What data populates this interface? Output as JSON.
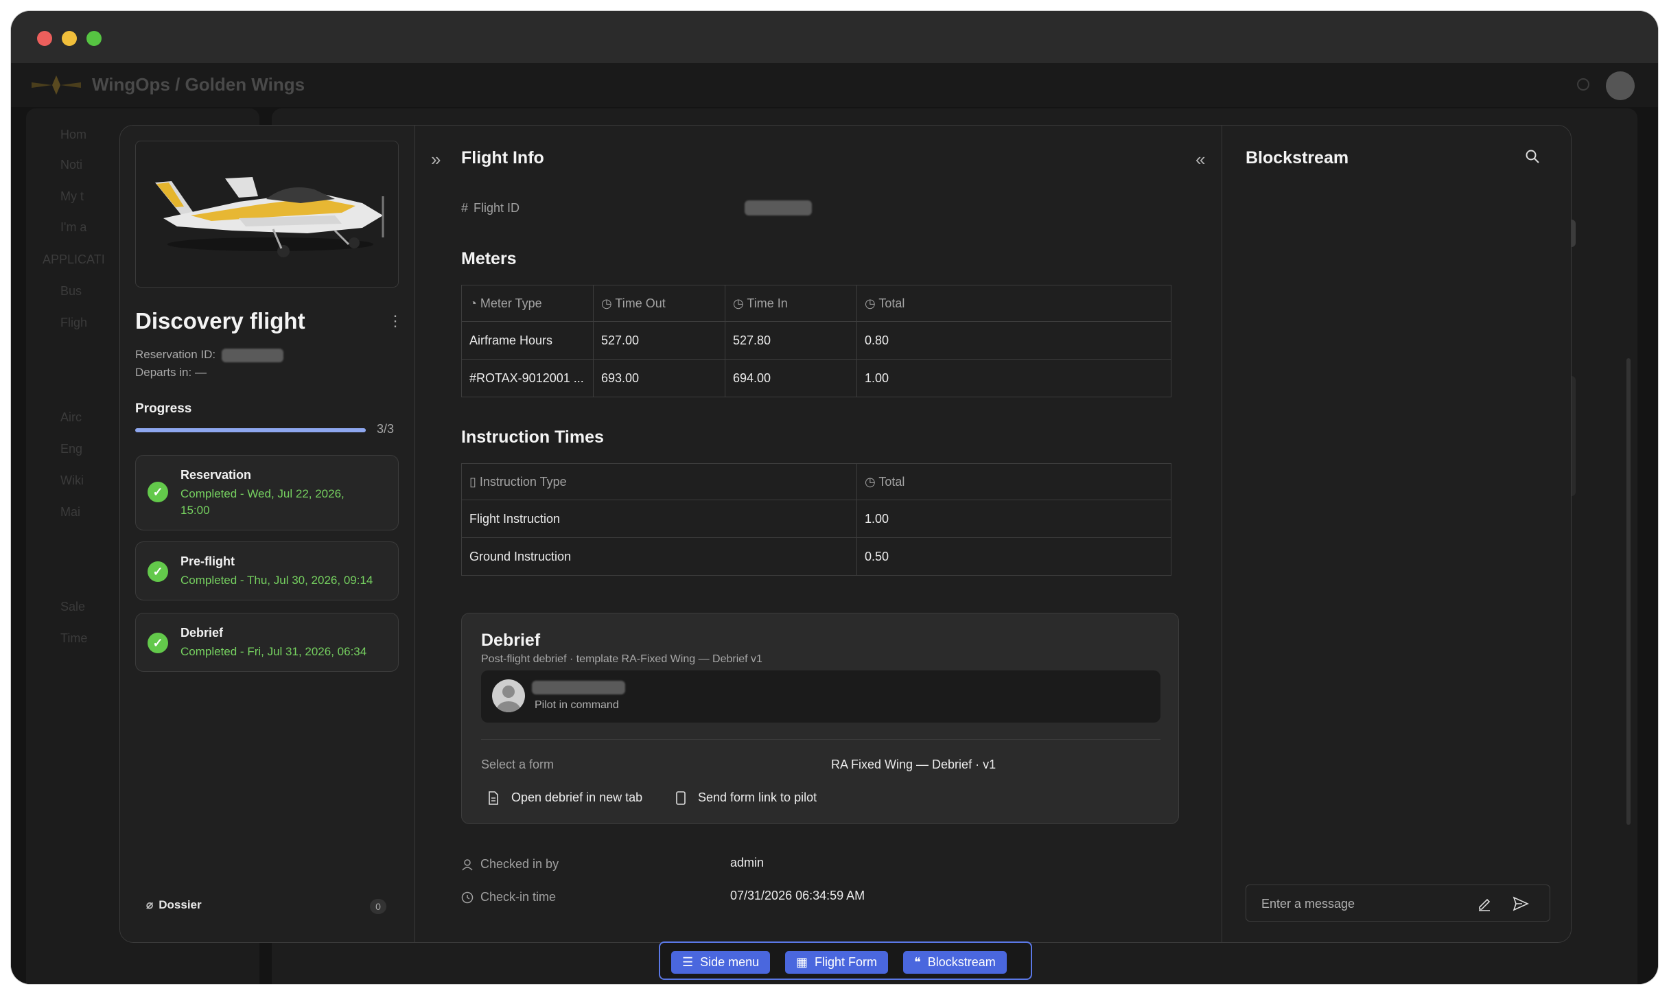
{
  "background_app": {
    "name": "WingOps / Golden Wings",
    "nav_items": [
      "Hom",
      "Noti",
      "My t",
      "I'm a",
      "APPLICATI",
      "Bus",
      "Fligh",
      "Airc",
      "Eng",
      "Wiki",
      "Mai",
      "Sale",
      "Time"
    ]
  },
  "left": {
    "title": "Discovery flight",
    "reservation_label": "Reservation ID:",
    "departs_label": "Departs in:",
    "departs_value": "—",
    "progress_label": "Progress",
    "progress_count": "3/3",
    "progress_fraction": 1.0,
    "steps": [
      {
        "title": "Reservation",
        "status": "Completed - Wed, Jul 22, 2026, 15:00"
      },
      {
        "title": "Pre-flight",
        "status": "Completed - Thu, Jul 30, 2026, 09:14"
      },
      {
        "title": "Debrief",
        "status": "Completed - Fri, Jul 31, 2026, 06:34"
      }
    ],
    "dossier_label": "Dossier",
    "dossier_count": "0"
  },
  "flight_info": {
    "title": "Flight Info",
    "flight_id_label": "Flight ID",
    "meters": {
      "title": "Meters",
      "headers": [
        "Meter Type",
        "Time Out",
        "Time In",
        "Total"
      ],
      "rows": [
        [
          "Airframe Hours",
          "527.00",
          "527.80",
          "0.80"
        ],
        [
          "#ROTAX-9012001 ...",
          "693.00",
          "694.00",
          "1.00"
        ]
      ]
    },
    "instruction": {
      "title": "Instruction Times",
      "headers": [
        "Instruction Type",
        "Total"
      ],
      "rows": [
        [
          "Flight Instruction",
          "1.00"
        ],
        [
          "Ground Instruction",
          "0.50"
        ]
      ]
    },
    "debrief": {
      "title": "Debrief",
      "subtitle": "Post-flight debrief · template RA-Fixed Wing — Debrief v1",
      "pilot_role": "Pilot in command",
      "select_label": "Select a form",
      "select_value": "RA Fixed Wing — Debrief · v1",
      "open_label": "Open debrief in new tab",
      "send_label": "Send form link to pilot"
    },
    "checked_in_by_label": "Checked in by",
    "checked_in_by_value": "admin",
    "checkin_time_label": "Check-in time",
    "checkin_time_value": "07/31/2026 06:34:59 AM"
  },
  "blockstream": {
    "title": "Blockstream",
    "message_placeholder": "Enter a message"
  },
  "toolbar": {
    "side_menu": "Side menu",
    "flight_form": "Flight Form",
    "blockstream": "Blockstream"
  },
  "colors": {
    "accent": "#4a67de",
    "success": "#63c94b",
    "progress": "#8ea7ef"
  }
}
